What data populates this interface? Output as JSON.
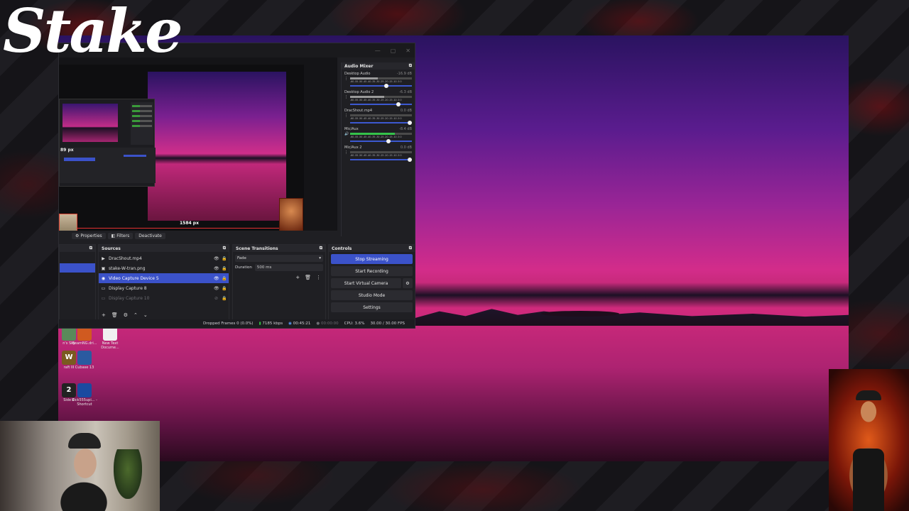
{
  "brand": {
    "logo_text": "Stake",
    "partial_text": "ke"
  },
  "desktop_icons": [
    {
      "label": "n's Sky",
      "color": "#5a8a5a",
      "glyph": ""
    },
    {
      "label": "BeamNG.dri...",
      "color": "#d05a20",
      "glyph": ""
    },
    {
      "label": "New Text Docume...",
      "color": "#f0f0f0",
      "glyph": ""
    },
    {
      "label": "raft III",
      "color": "#7a5a20",
      "glyph": "W"
    },
    {
      "label": "Cubase 13",
      "color": "#2a5aa0",
      "glyph": ""
    },
    {
      "label": "Side 2",
      "color": "#222",
      "glyph": "2"
    },
    {
      "label": "Kick555upi... - Shortcut",
      "color": "#1a4aa0",
      "glyph": ""
    }
  ],
  "preview": {
    "nested_px_label": "89 px",
    "measure_label": "1584 px"
  },
  "toolbar": {
    "properties": "Properties",
    "filters": "Filters",
    "deactivate": "Deactivate"
  },
  "mixer": {
    "title": "Audio Mixer",
    "scale": "-60 -55 -50 -45 -40 -35 -30 -25 -20 -15 -10 -5 0",
    "channels": [
      {
        "name": "Desktop Audio",
        "db": "-16.9 dB",
        "level": 0.45,
        "fader": 0.62,
        "meter_color": "#9a9a9a",
        "muted_icon": "menu-icon"
      },
      {
        "name": "Desktop Audio 2",
        "db": "-6.3 dB",
        "level": 0.55,
        "fader": 0.82,
        "meter_color": "#9a9a9a",
        "muted_icon": "menu-icon"
      },
      {
        "name": "DracShout.mp4",
        "db": "0.0 dB",
        "level": 0.0,
        "fader": 1.0,
        "meter_color": "#9a9a9a",
        "muted_icon": "menu-icon"
      },
      {
        "name": "Mic/Aux",
        "db": "-8.4 dB",
        "level": 0.72,
        "fader": 0.66,
        "meter_color": "#35c24a",
        "muted_icon": "speaker-icon"
      },
      {
        "name": "Mic/Aux 2",
        "db": "0.0 dB",
        "level": 0.0,
        "fader": 1.0,
        "meter_color": "#9a9a9a",
        "muted_icon": "menu-icon"
      }
    ]
  },
  "scenes": {
    "title": ""
  },
  "sources": {
    "title": "Sources",
    "items": [
      {
        "name": "DracShout.mp4",
        "icon": "play-icon",
        "glyph": "▶",
        "state": "normal"
      },
      {
        "name": "stake-W-tran.png",
        "icon": "image-icon",
        "glyph": "▣",
        "state": "normal"
      },
      {
        "name": "Video Capture Device 5",
        "icon": "camera-icon",
        "glyph": "◉",
        "state": "active"
      },
      {
        "name": "Display Capture 8",
        "icon": "monitor-icon",
        "glyph": "▭",
        "state": "normal"
      },
      {
        "name": "Display Capture 10",
        "icon": "monitor-icon",
        "glyph": "▭",
        "state": "dim"
      }
    ]
  },
  "transitions": {
    "title": "Scene Transitions",
    "selected": "Fade",
    "duration_label": "Duration",
    "duration_value": "500 ms"
  },
  "controls": {
    "title": "Controls",
    "stop_streaming": "Stop Streaming",
    "start_recording": "Start Recording",
    "start_virtual_camera": "Start Virtual Camera",
    "studio_mode": "Studio Mode",
    "settings": "Settings"
  },
  "status": {
    "dropped_frames": "Dropped Frames 0 (0.0%)",
    "bitrate": "7185 kbps",
    "stream_time": "00:45:21",
    "record_time": "00:00:00",
    "cpu": "CPU: 3.6%",
    "fps": "30.00 / 30.00 FPS"
  },
  "colors": {
    "accent": "#3b52c9",
    "meter_green": "#35c24a",
    "alert_red": "#e03030"
  }
}
